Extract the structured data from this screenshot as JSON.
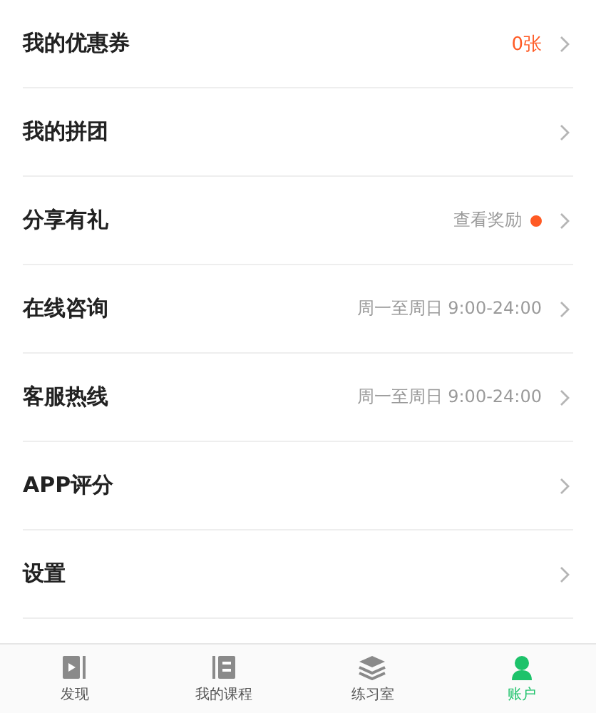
{
  "menu": [
    {
      "label": "我的优惠券",
      "value": "0张",
      "kind": "accent",
      "dot": false
    },
    {
      "label": "我的拼团",
      "dot": false
    },
    {
      "label": "分享有礼",
      "value": "查看奖励",
      "kind": "muted",
      "dot": true
    },
    {
      "label": "在线咨询",
      "value": "周一至周日 9:00-24:00",
      "kind": "muted",
      "dot": false
    },
    {
      "label": "客服热线",
      "value": "周一至周日 9:00-24:00",
      "kind": "muted",
      "dot": false
    },
    {
      "label": "APP评分",
      "dot": false
    },
    {
      "label": "设置",
      "dot": false
    }
  ],
  "tab_bar": [
    {
      "label": "发现",
      "kind": "discover",
      "selected": false
    },
    {
      "label": "我的课程",
      "kind": "courses",
      "selected": false
    },
    {
      "label": "练习室",
      "kind": "practice",
      "selected": false
    },
    {
      "label": "账户",
      "kind": "account",
      "selected": true
    }
  ]
}
